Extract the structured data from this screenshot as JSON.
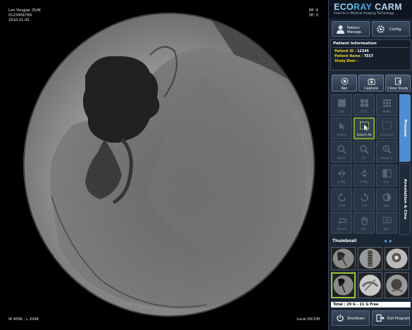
{
  "viewer": {
    "top_left": [
      "Lim Yongjae  35/M",
      "0123456789",
      "2010.01.05"
    ],
    "top_right": [
      "IM: 4",
      "SE: 0"
    ],
    "bottom_left": "W 4096 : L 2048",
    "bottom_right": "Local DICOM"
  },
  "brand": {
    "eco": "ECO",
    "ray": "RAY",
    "carm": "CARM",
    "tagline": "Experts in Medical Imaging Technology"
  },
  "top_buttons": {
    "patient": [
      "Patient",
      "Manage."
    ],
    "config": "Config."
  },
  "patient_info": {
    "title": "Patient Information",
    "rows": [
      {
        "label": "Patient ID :",
        "value": "12345"
      },
      {
        "label": "Patient Name :",
        "value": "TEST"
      },
      {
        "label": "Study Desc :",
        "value": ""
      }
    ]
  },
  "actions": [
    "Rec",
    "Capture",
    "Close Study"
  ],
  "tools": [
    {
      "label": "1x1",
      "icon": "layout-1x1-icon"
    },
    {
      "label": "2x2",
      "icon": "layout-2x2-icon"
    },
    {
      "label": "NxM",
      "icon": "layout-nxm-icon"
    },
    {
      "label": "Select",
      "icon": "pointer-icon"
    },
    {
      "label": "Select All",
      "icon": "select-all-icon"
    },
    {
      "label": "Unselect",
      "icon": "unselect-icon"
    },
    {
      "label": "Zoom",
      "icon": "zoom-icon"
    },
    {
      "label": "X1",
      "icon": "zoom-x1-icon"
    },
    {
      "label": "Magic S",
      "icon": "magic-zoom-icon"
    },
    {
      "label": "H-flip",
      "icon": "hflip-icon"
    },
    {
      "label": "V-flip",
      "icon": "vflip-icon"
    },
    {
      "label": "Inv.",
      "icon": "invert-icon"
    },
    {
      "label": "CCW",
      "icon": "rotate-ccw-icon"
    },
    {
      "label": "CW",
      "icon": "rotate-cw-icon"
    },
    {
      "label": "W/L",
      "icon": "window-level-icon"
    },
    {
      "label": "Reset",
      "icon": "reset-icon"
    },
    {
      "label": "Pan",
      "icon": "pan-hand-icon"
    },
    {
      "label": "Del.",
      "icon": "delete-icon"
    }
  ],
  "tabs": {
    "process": "Process",
    "annotation": "Annotation & Cine"
  },
  "thumbnail": {
    "title": "Thumbnail",
    "prev": "◀",
    "next": "▶",
    "selected_index": 3
  },
  "storage": "Total : 29 G - 21 G Free",
  "bottom_buttons": {
    "shutdown": "Shutdown",
    "exit": "Exit Program"
  },
  "colors": {
    "accent_active": "#9cc23c",
    "label_yellow": "#f0d028",
    "process_tab": "#4e8ed0"
  }
}
